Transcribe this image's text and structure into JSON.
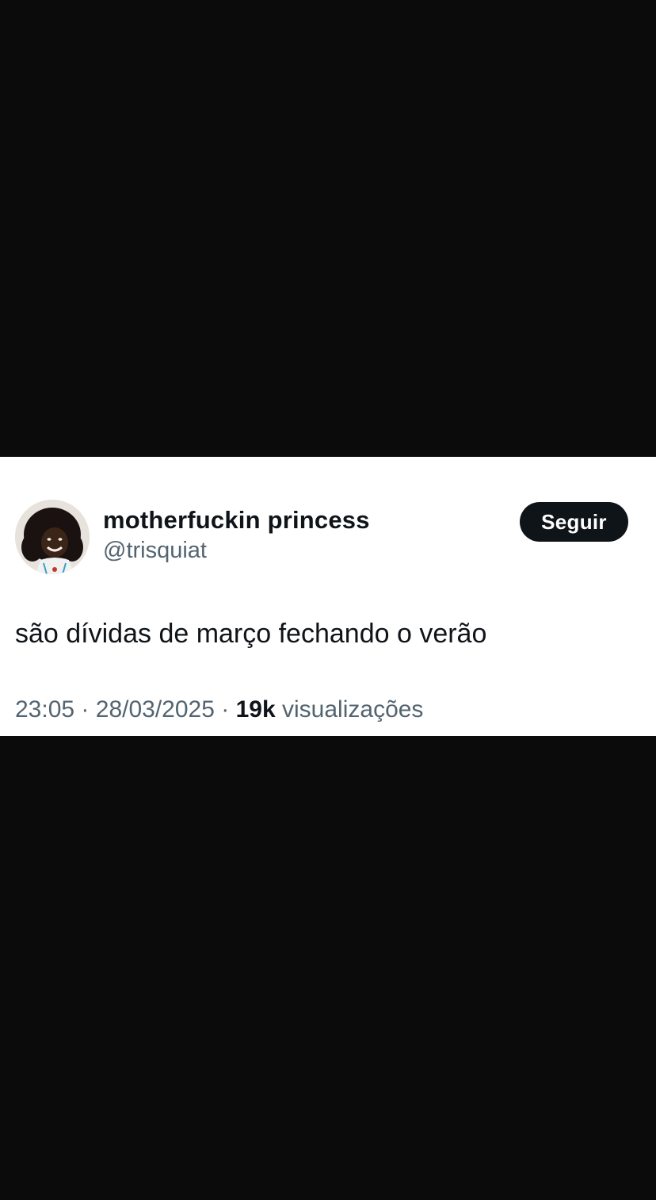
{
  "tweet": {
    "display_name": "motherfuckin princess",
    "handle": "@trisquiat",
    "follow_label": "Seguir",
    "text": "são dívidas de março fechando o verão",
    "time": "23:05",
    "separator": "·",
    "date": "28/03/2025",
    "views_count": "19k",
    "views_label": "visualizações"
  },
  "colors": {
    "background": "#0b0b0c",
    "card": "#ffffff",
    "primary_text": "#0f1419",
    "secondary_text": "#536471",
    "button_bg": "#0f1419"
  }
}
